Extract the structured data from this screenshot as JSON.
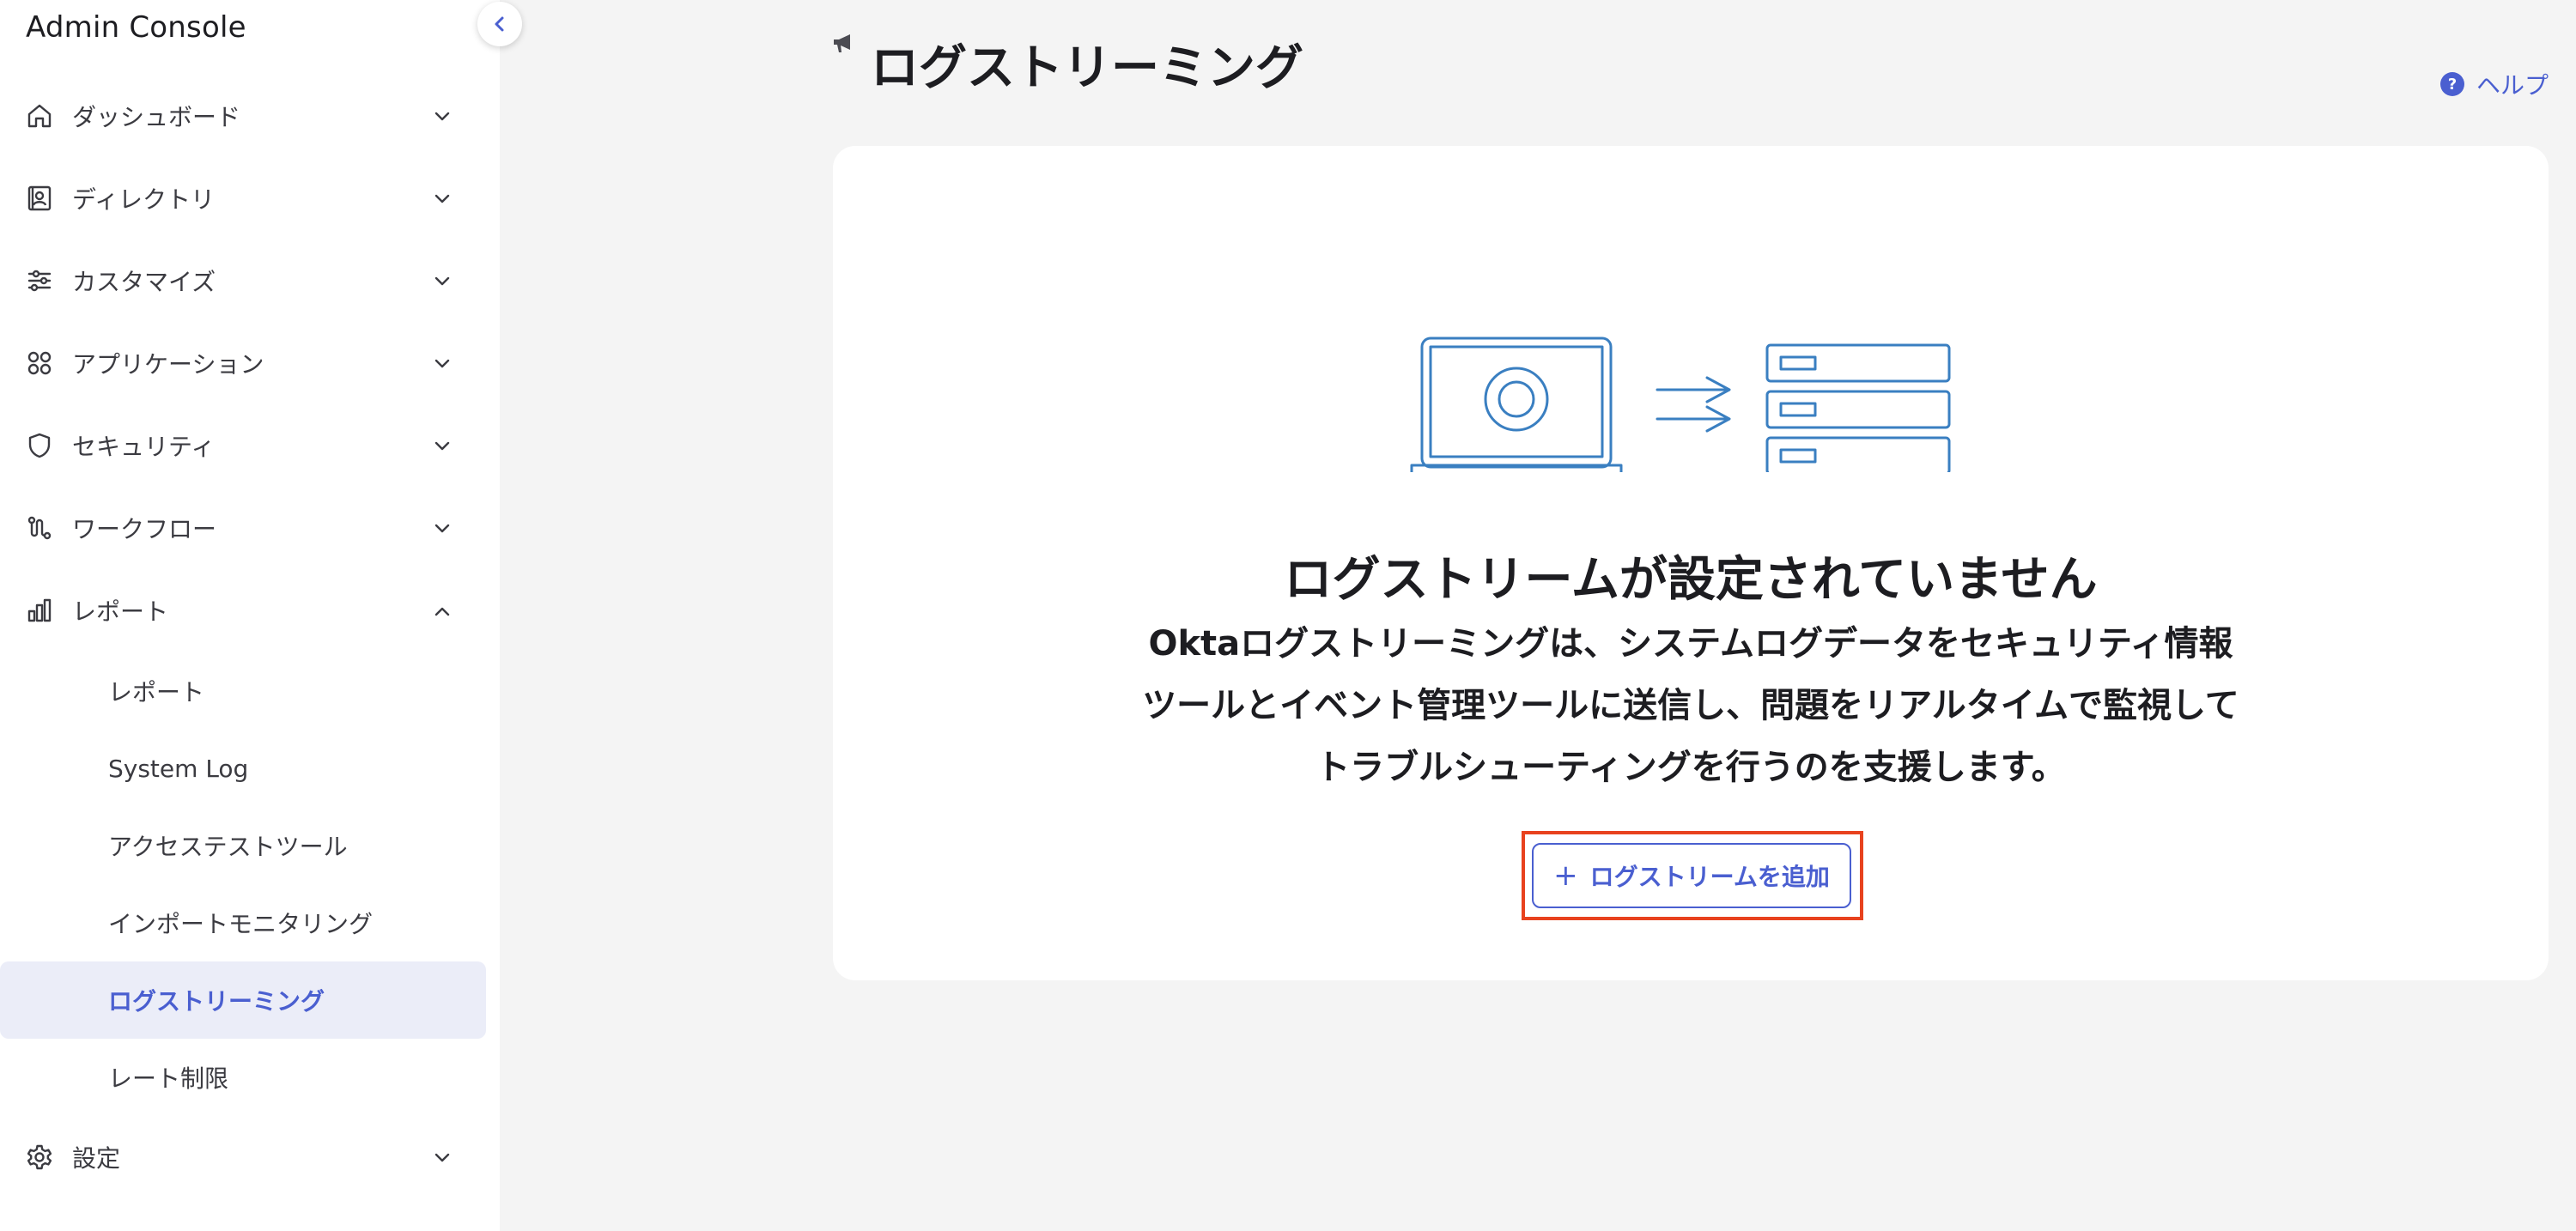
{
  "app": {
    "title": "Admin Console"
  },
  "sidebar": {
    "items": [
      {
        "label": "ダッシュボード",
        "icon": "home-icon",
        "expanded": false
      },
      {
        "label": "ディレクトリ",
        "icon": "directory-icon",
        "expanded": false
      },
      {
        "label": "カスタマイズ",
        "icon": "sliders-icon",
        "expanded": false
      },
      {
        "label": "アプリケーション",
        "icon": "apps-grid-icon",
        "expanded": false
      },
      {
        "label": "セキュリティ",
        "icon": "shield-icon",
        "expanded": false
      },
      {
        "label": "ワークフロー",
        "icon": "workflow-icon",
        "expanded": false
      },
      {
        "label": "レポート",
        "icon": "bar-chart-icon",
        "expanded": true
      },
      {
        "label": "設定",
        "icon": "gear-icon",
        "expanded": false
      }
    ],
    "report_sub": [
      {
        "label": "レポート",
        "active": false
      },
      {
        "label": "System Log",
        "active": false
      },
      {
        "label": "アクセステストツール",
        "active": false
      },
      {
        "label": "インポートモニタリング",
        "active": false
      },
      {
        "label": "ログストリーミング",
        "active": true
      },
      {
        "label": "レート制限",
        "active": false
      }
    ]
  },
  "main": {
    "title": "ログストリーミング",
    "help_label": "ヘルプ",
    "help_icon_glyph": "?",
    "empty_state": {
      "heading": "ログストリームが設定されていません",
      "description_lines": [
        "Oktaログストリーミングは、システムログデータをセキュリティ情報",
        "ツールとイベント管理ツールに送信し、問題をリアルタイムで監視して",
        "トラブルシューティングを行うのを支援します。"
      ],
      "button_label": "ログストリームを追加",
      "button_icon": "plus-icon"
    }
  },
  "colors": {
    "accent": "#4a5fd0",
    "highlight": "#e8421e",
    "illustration": "#3a7fc1",
    "background": "#f4f4f4"
  }
}
